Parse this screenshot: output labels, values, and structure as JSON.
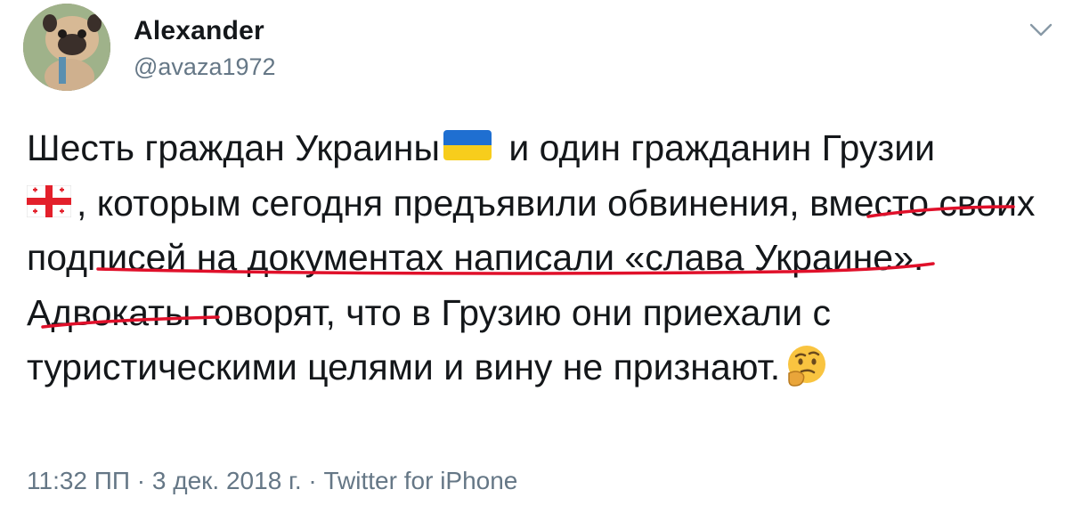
{
  "author": {
    "name": "Alexander",
    "handle": "@avaza1972"
  },
  "tweet": {
    "text_part1": "Шесть граждан Украины",
    "text_part2": " и один гражданин Грузии ",
    "text_part3": ", которым сегодня предъявили обвинения, вместо своих подписей на документах написали «слава Украине». Адвокаты говорят, что в Грузию они приехали с туристическими целями и вину не признают.",
    "icons": [
      "ukraine-flag-icon",
      "georgia-flag-icon",
      "thinking-face-icon"
    ]
  },
  "meta": {
    "timestamp": "11:32 ПП · 3 дек. 2018 г. · Twitter for iPhone"
  },
  "colors": {
    "text": "#14171a",
    "secondary": "#657786",
    "annotation": "#e0102a"
  }
}
